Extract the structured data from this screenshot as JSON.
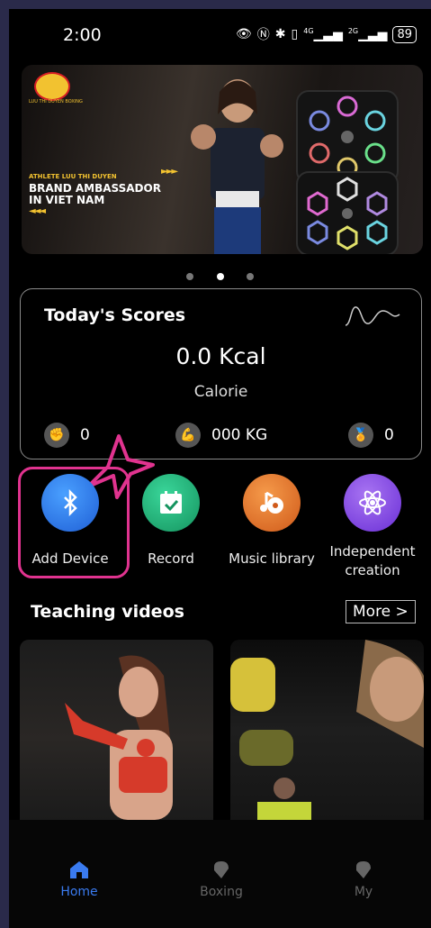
{
  "status": {
    "time": "2:00",
    "signal1": "4G",
    "signal2": "2G",
    "battery": "89"
  },
  "banner": {
    "logo_text": "LUU THI DUYEN BOXING",
    "athlete": "ATHLETE LUU THI DUYEN",
    "brand_line1": "BRAND AMBASSADOR",
    "brand_line2": "IN VIET NAM",
    "arrows_right": "►►►",
    "arrows_left": "◄◄◄",
    "page_count": 3,
    "active_page": 2
  },
  "scores": {
    "title": "Today's Scores",
    "calorie_value": "0.0 Kcal",
    "calorie_label": "Calorie",
    "stats": [
      {
        "icon": "glove-icon",
        "value": "0"
      },
      {
        "icon": "muscle-icon",
        "value": "000 KG"
      },
      {
        "icon": "medal-icon",
        "value": "0"
      }
    ]
  },
  "shortcuts": [
    {
      "label": "Add Device",
      "icon": "bluetooth-icon",
      "color": "#2f7de6"
    },
    {
      "label": "Record",
      "icon": "calendar-check-icon",
      "color": "#1fb37a"
    },
    {
      "label": "Music library",
      "icon": "music-note-icon",
      "color": "#e8742a"
    },
    {
      "label": "Independent creation",
      "icon": "atom-icon",
      "color": "#8e4fe6"
    }
  ],
  "teaching": {
    "title": "Teaching videos",
    "more": "More >"
  },
  "nav": [
    {
      "label": "Home",
      "active": true
    },
    {
      "label": "Boxing",
      "active": false
    },
    {
      "label": "My",
      "active": false
    }
  ],
  "colors": {
    "accent": "#3a7bf0",
    "highlight": "#e0338f",
    "brand_yellow": "#f2c230"
  }
}
